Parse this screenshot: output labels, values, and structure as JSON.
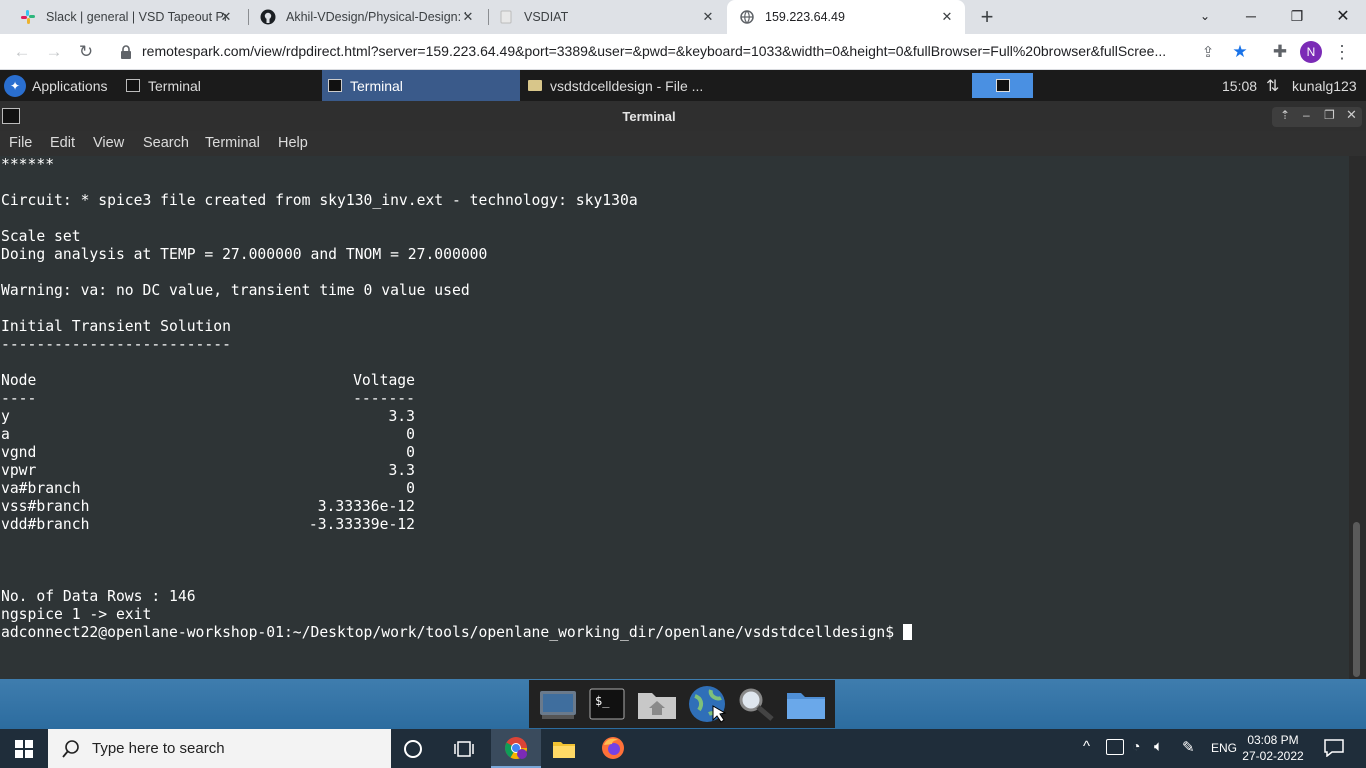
{
  "browser": {
    "tabs": [
      {
        "title": "Slack | general | VSD Tapeout Pro",
        "icon": "slack-icon"
      },
      {
        "title": "Akhil-VDesign/Physical-Design: V",
        "icon": "github-icon"
      },
      {
        "title": "VSDIAT",
        "icon": "page-icon"
      },
      {
        "title": "159.223.64.49",
        "icon": "globe-icon"
      }
    ],
    "url": "remotespark.com/view/rdpdirect.html?server=159.223.64.49&port=3389&user=&pwd=&keyboard=1033&width=0&height=0&fullBrowser=Full%20browser&fullScree...",
    "profile_initial": "N"
  },
  "xfce_panel": {
    "applications_label": "Applications",
    "tasks": [
      {
        "label": "Terminal"
      },
      {
        "label": "Terminal"
      },
      {
        "label": "vsdstdcelldesign - File ..."
      }
    ],
    "clock": "15:08",
    "user": "kunalg123"
  },
  "terminal": {
    "window_title": "Terminal",
    "menu": [
      "File",
      "Edit",
      "View",
      "Search",
      "Terminal",
      "Help"
    ],
    "lines": [
      "******",
      "",
      "Circuit: * spice3 file created from sky130_inv.ext - technology: sky130a",
      "",
      "Scale set",
      "Doing analysis at TEMP = 27.000000 and TNOM = 27.000000",
      "",
      "Warning: va: no DC value, transient time 0 value used",
      "",
      "Initial Transient Solution",
      "--------------------------"
    ],
    "table_header": {
      "node": "Node",
      "voltage": "Voltage"
    },
    "table_rule": {
      "node": "----",
      "voltage": "-------"
    },
    "rows": [
      {
        "node": "y",
        "voltage": "3.3"
      },
      {
        "node": "a",
        "voltage": "0"
      },
      {
        "node": "vgnd",
        "voltage": "0"
      },
      {
        "node": "vpwr",
        "voltage": "3.3"
      },
      {
        "node": "va#branch",
        "voltage": "0"
      },
      {
        "node": "vss#branch",
        "voltage": "3.33336e-12"
      },
      {
        "node": "vdd#branch",
        "voltage": "-3.33339e-12"
      }
    ],
    "data_rows_line": "No. of Data Rows : 146",
    "exit_line": "ngspice 1 -> exit",
    "prompt": "adconnect22@openlane-workshop-01:~/Desktop/work/tools/openlane_working_dir/openlane/vsdstdcelldesign$ "
  },
  "windows_taskbar": {
    "search_placeholder": "Type here to search",
    "language": "ENG",
    "time": "03:08 PM",
    "date": "27-02-2022"
  }
}
